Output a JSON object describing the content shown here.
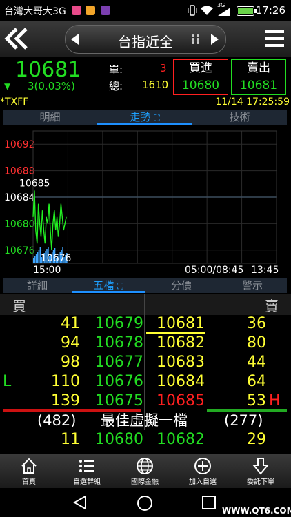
{
  "status_bar": {
    "carrier": "台灣大哥大3G",
    "network": "3G",
    "time": "17:26"
  },
  "top_nav": {
    "back_icon": "double-chevron-left-icon",
    "title": "台指近全",
    "menu_icon": "hamburger-icon"
  },
  "quote": {
    "price": "10681",
    "change": "3(0.03%)",
    "single_label": "單:",
    "single_value": "3",
    "total_label": "總:",
    "total_value": "1610",
    "buy_label": "買進",
    "buy_price": "10680",
    "sell_label": "賣出",
    "sell_price": "10681"
  },
  "sub_header": {
    "symbol": "*TXFF",
    "datetime": "11/14 17:25:59"
  },
  "tabs_top": [
    {
      "label": "明細"
    },
    {
      "label": "走勢"
    },
    {
      "label": "技術"
    }
  ],
  "chart_data": {
    "type": "line",
    "y_ticks": [
      "10692",
      "10688",
      "10684",
      "10680",
      "10676"
    ],
    "ylim": [
      10674,
      10694
    ],
    "reference_price": 10684,
    "high_label": "10685",
    "low_label": "10676",
    "x_start": "15:00",
    "x_mid": "05:00/08:45",
    "x_end": "13:45",
    "series": [
      {
        "values": [
          10681,
          10685,
          10679,
          10677,
          10683,
          10680,
          10678,
          10682,
          10679,
          10677,
          10681,
          10680,
          10683,
          10679,
          10676,
          10680,
          10682,
          10679,
          10681,
          10678,
          10680,
          10683,
          10681,
          10679,
          10680,
          10681
        ]
      }
    ]
  },
  "tabs_bottom": [
    {
      "label": "詳細"
    },
    {
      "label": "五檔"
    },
    {
      "label": "分價"
    },
    {
      "label": "警示"
    }
  ],
  "book": {
    "buy_header": "買",
    "sell_header": "賣",
    "rows": [
      {
        "marker": "",
        "bid_qty": "41",
        "bid_price": "10679",
        "ask_price": "10681",
        "ask_qty": "36",
        "tag": ""
      },
      {
        "marker": "",
        "bid_qty": "94",
        "bid_price": "10678",
        "ask_price": "10682",
        "ask_qty": "80",
        "tag": ""
      },
      {
        "marker": "",
        "bid_qty": "98",
        "bid_price": "10677",
        "ask_price": "10683",
        "ask_qty": "44",
        "tag": ""
      },
      {
        "marker": "L",
        "bid_qty": "110",
        "bid_price": "10676",
        "ask_price": "10684",
        "ask_qty": "64",
        "tag": ""
      },
      {
        "marker": "",
        "bid_qty": "139",
        "bid_price": "10675",
        "ask_price": "10685",
        "ask_qty": "53",
        "tag": "H"
      }
    ],
    "bid_total": "(482)",
    "best_label": "最佳虛擬一檔",
    "ask_total": "(277)",
    "best_bid_qty": "11",
    "best_bid_price": "10680",
    "best_ask_price": "10682",
    "best_ask_qty": "29"
  },
  "bottom_nav": [
    {
      "label": "首頁",
      "icon": "home-icon"
    },
    {
      "label": "自選群組",
      "icon": "list-icon"
    },
    {
      "label": "國際金融",
      "icon": "globe-icon"
    },
    {
      "label": "加入自選",
      "icon": "plus-circle-icon"
    },
    {
      "label": "委託下單",
      "icon": "download-arrow-icon"
    }
  ],
  "watermark": "WWW.QT6.COM"
}
